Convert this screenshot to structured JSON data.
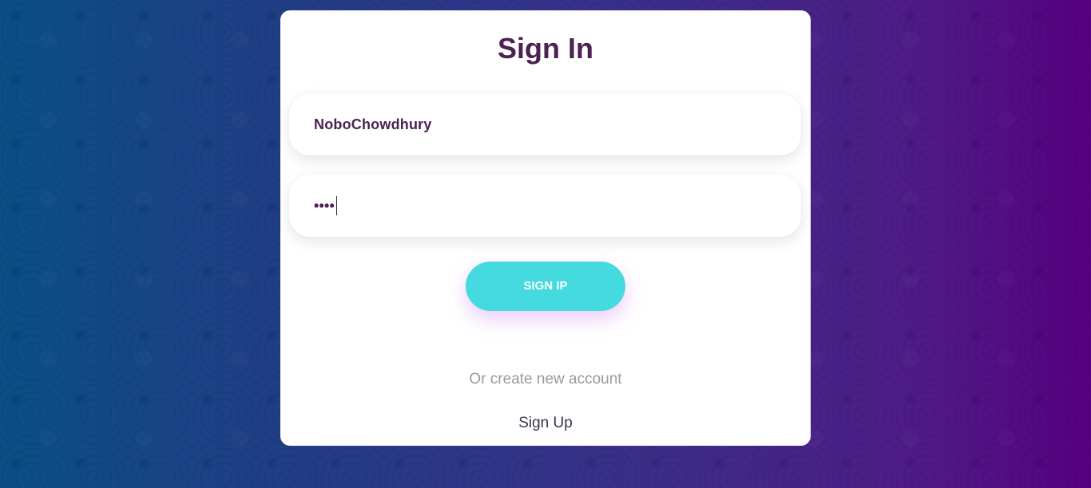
{
  "login": {
    "title": "Sign In",
    "username_value": "NoboChowdhury",
    "password_mask": "••••",
    "submit_label": "SIGN IP",
    "alt_text": "Or create new account",
    "signup_label": "Sign Up"
  },
  "colors": {
    "title": "#4b2251",
    "button": "#45dadf",
    "background_left": "#0a4f86",
    "background_right": "#560080"
  }
}
